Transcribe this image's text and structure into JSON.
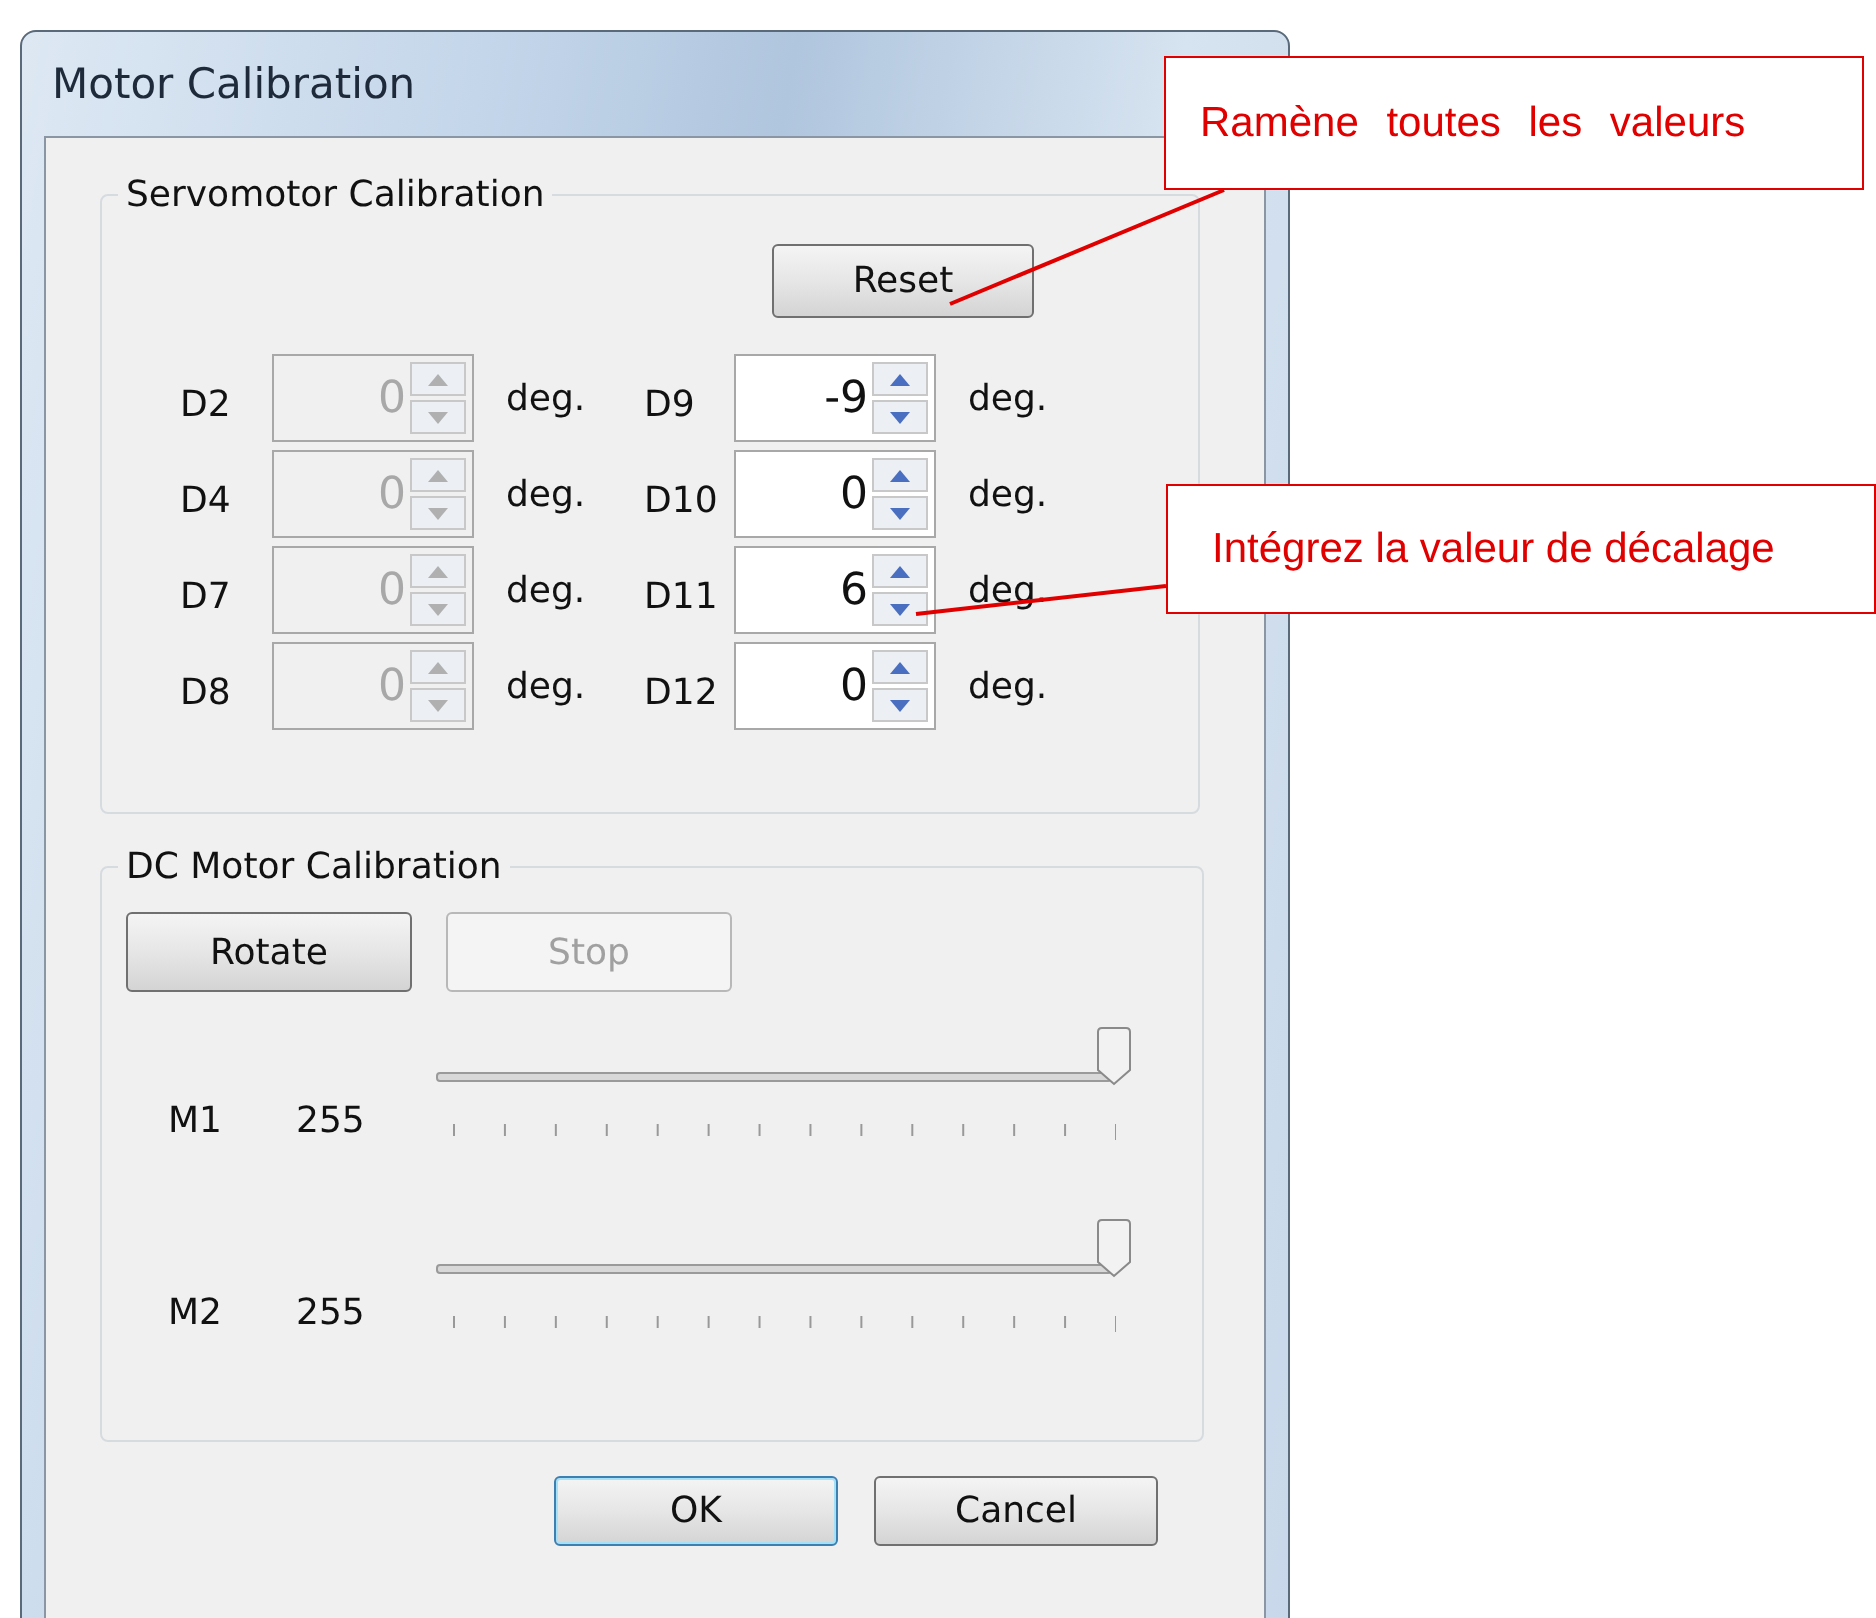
{
  "window": {
    "title": "Motor Calibration"
  },
  "servo": {
    "title": "Servomotor Calibration",
    "reset_button": "Reset",
    "channels": [
      {
        "name": "D2",
        "value": "0",
        "unit": "deg.",
        "disabled": true
      },
      {
        "name": "D9",
        "value": "-9",
        "unit": "deg.",
        "disabled": false
      },
      {
        "name": "D4",
        "value": "0",
        "unit": "deg.",
        "disabled": true
      },
      {
        "name": "D10",
        "value": "0",
        "unit": "deg.",
        "disabled": false
      },
      {
        "name": "D7",
        "value": "0",
        "unit": "deg.",
        "disabled": true
      },
      {
        "name": "D11",
        "value": "6",
        "unit": "deg.",
        "disabled": false
      },
      {
        "name": "D8",
        "value": "0",
        "unit": "deg.",
        "disabled": true
      },
      {
        "name": "D12",
        "value": "0",
        "unit": "deg.",
        "disabled": false
      }
    ]
  },
  "dc": {
    "title": "DC Motor Calibration",
    "buttons": [
      {
        "label": "Rotate",
        "disabled": false
      },
      {
        "label": "Stop",
        "disabled": true
      }
    ],
    "motors": [
      {
        "name": "M1",
        "reading": "255",
        "level": 1
      },
      {
        "name": "M2",
        "reading": "255",
        "level": 1
      }
    ]
  },
  "buttons": [
    {
      "label": "OK",
      "default": true
    },
    {
      "label": "Cancel",
      "default": false
    }
  ],
  "callouts": [
    {
      "text": "Ramène toutes les valeurs"
    },
    {
      "text": "Intégrez la valeur de décalage"
    }
  ]
}
